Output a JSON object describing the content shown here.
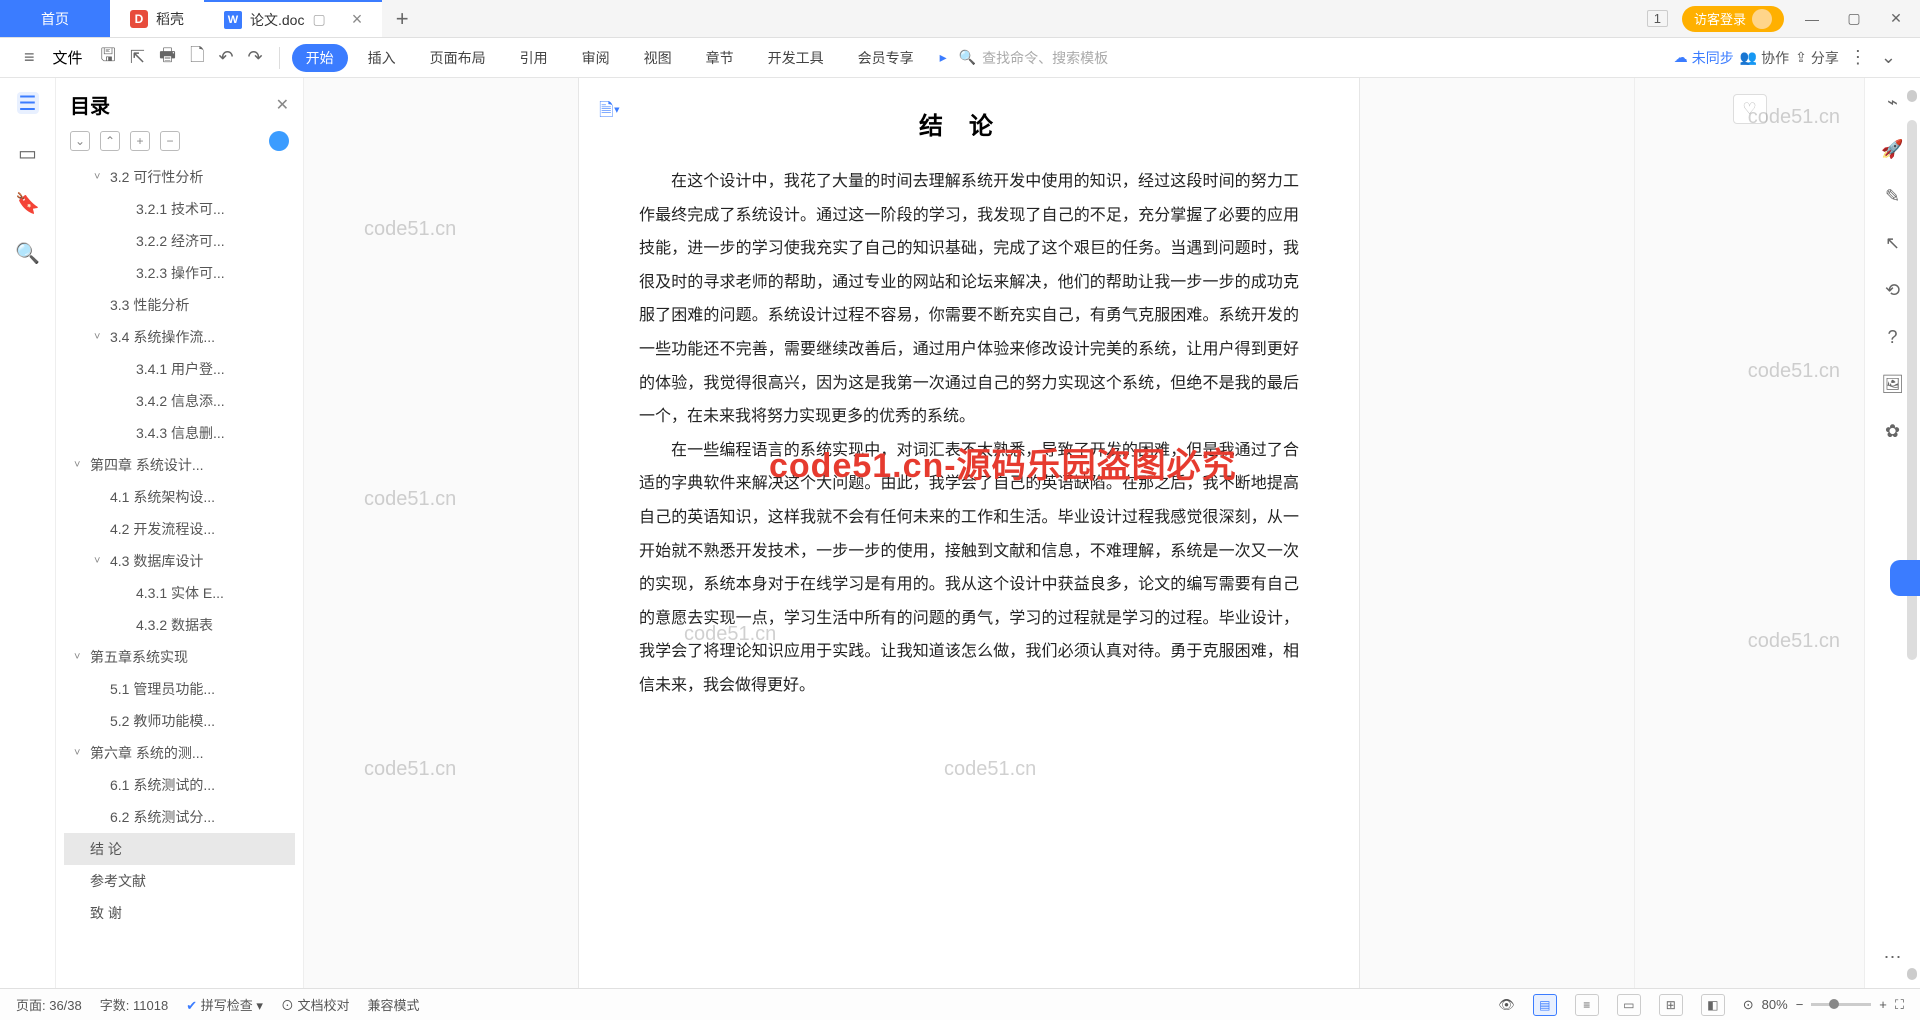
{
  "title_bar": {
    "home": "首页",
    "docer": "稻壳",
    "doc_tab": "论文.doc",
    "counter": "1",
    "login": "访客登录"
  },
  "menu": {
    "file": "文件",
    "tabs": [
      "开始",
      "插入",
      "页面布局",
      "引用",
      "审阅",
      "视图",
      "章节",
      "开发工具",
      "会员专享"
    ],
    "search_placeholder": "查找命令、搜索模板",
    "unsync": "未同步",
    "collab": "协作",
    "share": "分享"
  },
  "outline": {
    "title": "目录",
    "items": [
      {
        "label": "3.2 可行性分析",
        "level": 2,
        "expand": true
      },
      {
        "label": "3.2.1 技术可...",
        "level": 3
      },
      {
        "label": "3.2.2 经济可...",
        "level": 3
      },
      {
        "label": "3.2.3 操作可...",
        "level": 3
      },
      {
        "label": "3.3 性能分析",
        "level": 2
      },
      {
        "label": "3.4 系统操作流...",
        "level": 2,
        "expand": true
      },
      {
        "label": "3.4.1 用户登...",
        "level": 3
      },
      {
        "label": "3.4.2 信息添...",
        "level": 3
      },
      {
        "label": "3.4.3 信息删...",
        "level": 3
      },
      {
        "label": "第四章  系统设计...",
        "level": 1,
        "expand": true
      },
      {
        "label": "4.1 系统架构设...",
        "level": 2
      },
      {
        "label": "4.2 开发流程设...",
        "level": 2
      },
      {
        "label": "4.3 数据库设计",
        "level": 2,
        "expand": true
      },
      {
        "label": "4.3.1 实体 E...",
        "level": 3
      },
      {
        "label": "4.3.2 数据表",
        "level": 3
      },
      {
        "label": "第五章系统实现",
        "level": 1,
        "expand": true
      },
      {
        "label": "5.1 管理员功能...",
        "level": 2
      },
      {
        "label": "5.2 教师功能模...",
        "level": 2
      },
      {
        "label": "第六章   系统的测...",
        "level": 1,
        "expand": true
      },
      {
        "label": "6.1 系统测试的...",
        "level": 2
      },
      {
        "label": "6.2 系统测试分...",
        "level": 2
      },
      {
        "label": "结   论",
        "level": 1,
        "selected": true
      },
      {
        "label": "参考文献",
        "level": 1
      },
      {
        "label": "致   谢",
        "level": 1
      }
    ]
  },
  "document": {
    "heading": "结论",
    "p1": "在这个设计中，我花了大量的时间去理解系统开发中使用的知识，经过这段时间的努力工作最终完成了系统设计。通过这一阶段的学习，我发现了自己的不足，充分掌握了必要的应用技能，进一步的学习使我充实了自己的知识基础，完成了这个艰巨的任务。当遇到问题时，我很及时的寻求老师的帮助，通过专业的网站和论坛来解决，他们的帮助让我一步一步的成功克服了困难的问题。系统设计过程不容易，你需要不断充实自己，有勇气克服困难。系统开发的一些功能还不完善，需要继续改善后，通过用户体验来修改设计完美的系统，让用户得到更好的体验，我觉得很高兴，因为这是我第一次通过自己的努力实现这个系统，但绝不是我的最后一个，在未来我将努力实现更多的优秀的系统。",
    "p2": "在一些编程语言的系统实现中，对词汇表不太熟悉，导致了开发的困难，但是我通过了合适的字典软件来解决这个大问题。由此，我学会了自己的英语缺陷。在那之后，我不断地提高自己的英语知识，这样我就不会有任何未来的工作和生活。毕业设计过程我感觉很深刻，从一开始就不熟悉开发技术，一步一步的使用，接触到文献和信息，不难理解，系统是一次又一次的实现，系统本身对于在线学习是有用的。我从这个设计中获益良多，论文的编写需要有自己的意愿去实现一点，学习生活中所有的问题的勇气，学习的过程就是学习的过程。毕业设计，我学会了将理论知识应用于实践。让我知道该怎么做，我们必须认真对待。勇于克服困难，相信未来，我会做得更好。"
  },
  "watermarks": {
    "text": "code51.cn",
    "red": "code51.cn-源码乐园盗图必究"
  },
  "status": {
    "page": "页面: 36/38",
    "words": "字数: 11018",
    "spell": "拼写检查",
    "proof": "文档校对",
    "compat": "兼容模式",
    "zoom": "80%"
  }
}
